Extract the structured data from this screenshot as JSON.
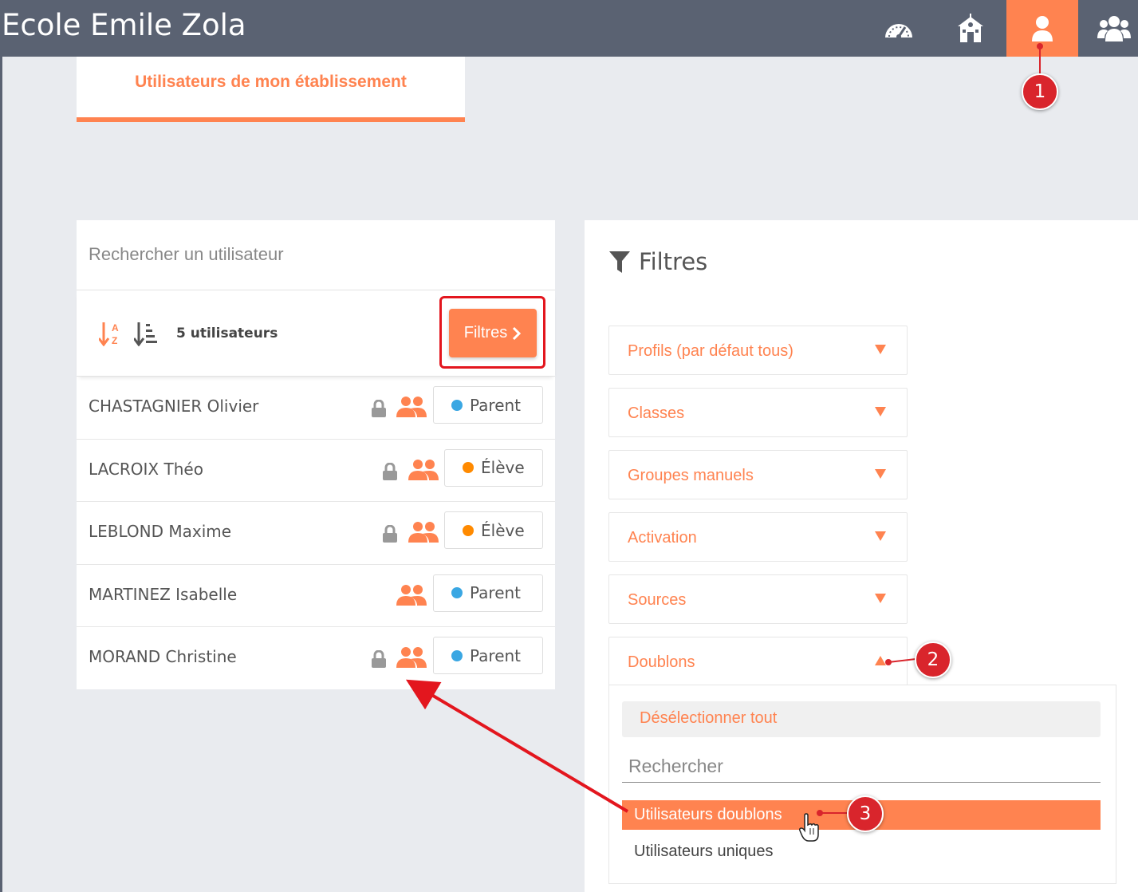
{
  "app": {
    "title": "Ecole Emile Zola"
  },
  "nav": {
    "items": [
      {
        "icon": "dashboard-gauge-icon",
        "active": false
      },
      {
        "icon": "school-building-icon",
        "active": false
      },
      {
        "icon": "user-icon",
        "active": true
      },
      {
        "icon": "users-group-icon",
        "active": false
      }
    ]
  },
  "tab": {
    "label": "Utilisateurs de mon établissement"
  },
  "search": {
    "placeholder": "Rechercher un utilisateur"
  },
  "toolbar": {
    "count_label": "5 utilisateurs",
    "filters_button": "Filtres"
  },
  "users": [
    {
      "name": "CHASTAGNIER Olivier",
      "locked": true,
      "role": "Parent",
      "role_color": "#3aa7e3"
    },
    {
      "name": "LACROIX Théo",
      "locked": true,
      "role": "Élève",
      "role_color": "#ff8a00"
    },
    {
      "name": "LEBLOND Maxime",
      "locked": true,
      "role": "Élève",
      "role_color": "#ff8a00"
    },
    {
      "name": "MARTINEZ Isabelle",
      "locked": false,
      "role": "Parent",
      "role_color": "#3aa7e3"
    },
    {
      "name": "MORAND Christine",
      "locked": true,
      "role": "Parent",
      "role_color": "#3aa7e3"
    }
  ],
  "filters": {
    "title": "Filtres",
    "sections": [
      {
        "label": "Profils (par défaut tous)",
        "open": false
      },
      {
        "label": "Classes",
        "open": false
      },
      {
        "label": "Groupes manuels",
        "open": false
      },
      {
        "label": "Activation",
        "open": false
      },
      {
        "label": "Sources",
        "open": false
      },
      {
        "label": "Doublons",
        "open": true
      }
    ],
    "doublons": {
      "deselect_all": "Désélectionner tout",
      "search_placeholder": "Rechercher",
      "options": [
        {
          "label": "Utilisateurs doublons",
          "selected": true
        },
        {
          "label": "Utilisateurs uniques",
          "selected": false
        }
      ]
    }
  },
  "annotations": {
    "callouts": [
      "1",
      "2",
      "3"
    ],
    "accent_color": "#ff8350",
    "callout_color": "#d9252c"
  }
}
